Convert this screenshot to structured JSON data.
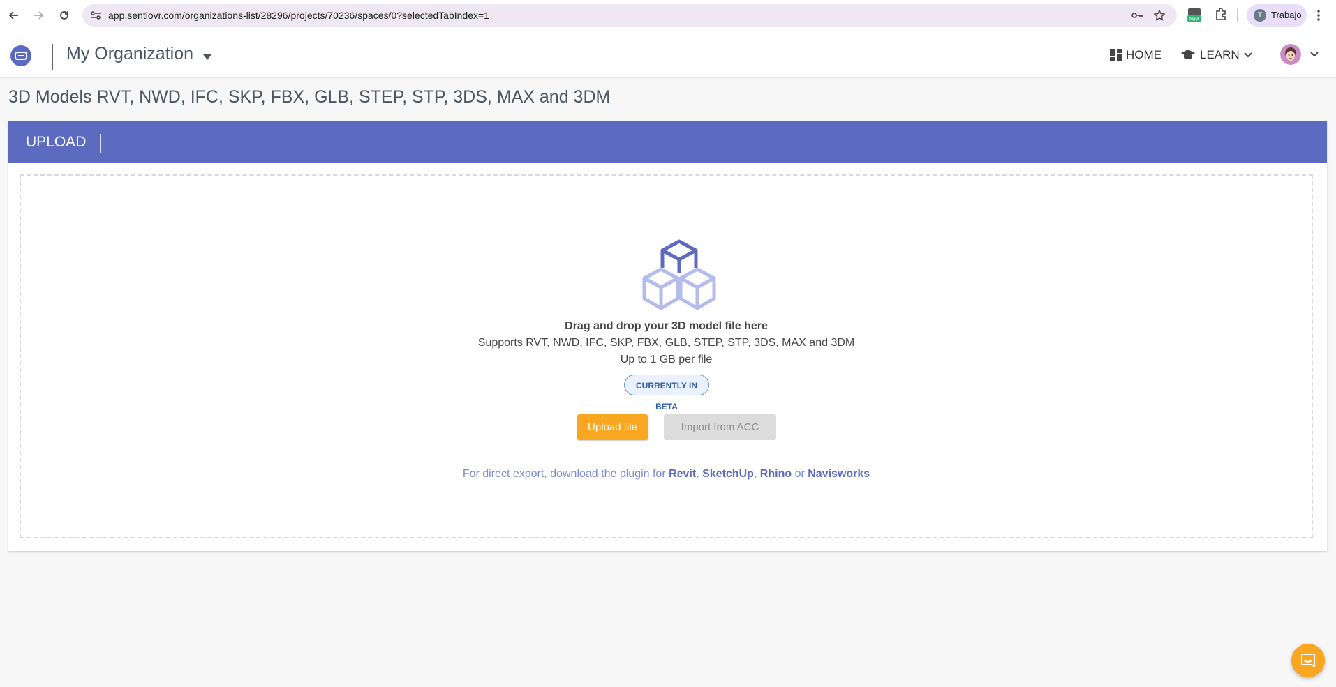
{
  "browser": {
    "url": "app.sentiovr.com/organizations-list/28296/projects/70236/spaces/0?selectedTabIndex=1",
    "profile_initial": "T",
    "profile_name": "Trabajo",
    "new_badge": "New"
  },
  "header": {
    "org_name": "My Organization",
    "nav_home": "HOME",
    "nav_learn": "LEARN"
  },
  "page": {
    "title": "3D Models RVT, NWD, IFC, SKP, FBX, GLB, STEP, STP, 3DS, MAX and 3DM"
  },
  "upload": {
    "tab_label": "UPLOAD",
    "dropzone_title": "Drag and drop your 3D model file here",
    "supported_formats": "Supports RVT, NWD, IFC, SKP, FBX, GLB, STEP, STP, 3DS, MAX and 3DM",
    "size_limit": "Up to 1 GB per file",
    "beta_badge": "CURRENTLY IN BETA",
    "upload_button": "Upload file",
    "import_button": "Import from ACC",
    "plugin_prefix": "For direct export, download the plugin for ",
    "plugin_revit": "Revit",
    "plugin_sep1": ", ",
    "plugin_sketchup": "SketchUp",
    "plugin_sep2": ", ",
    "plugin_rhino": "Rhino",
    "plugin_or": " or ",
    "plugin_navisworks": "Navisworks"
  },
  "colors": {
    "accent": "#5c6bc0",
    "upload_button": "#f9a620",
    "beta_border": "#5f8fe0"
  }
}
